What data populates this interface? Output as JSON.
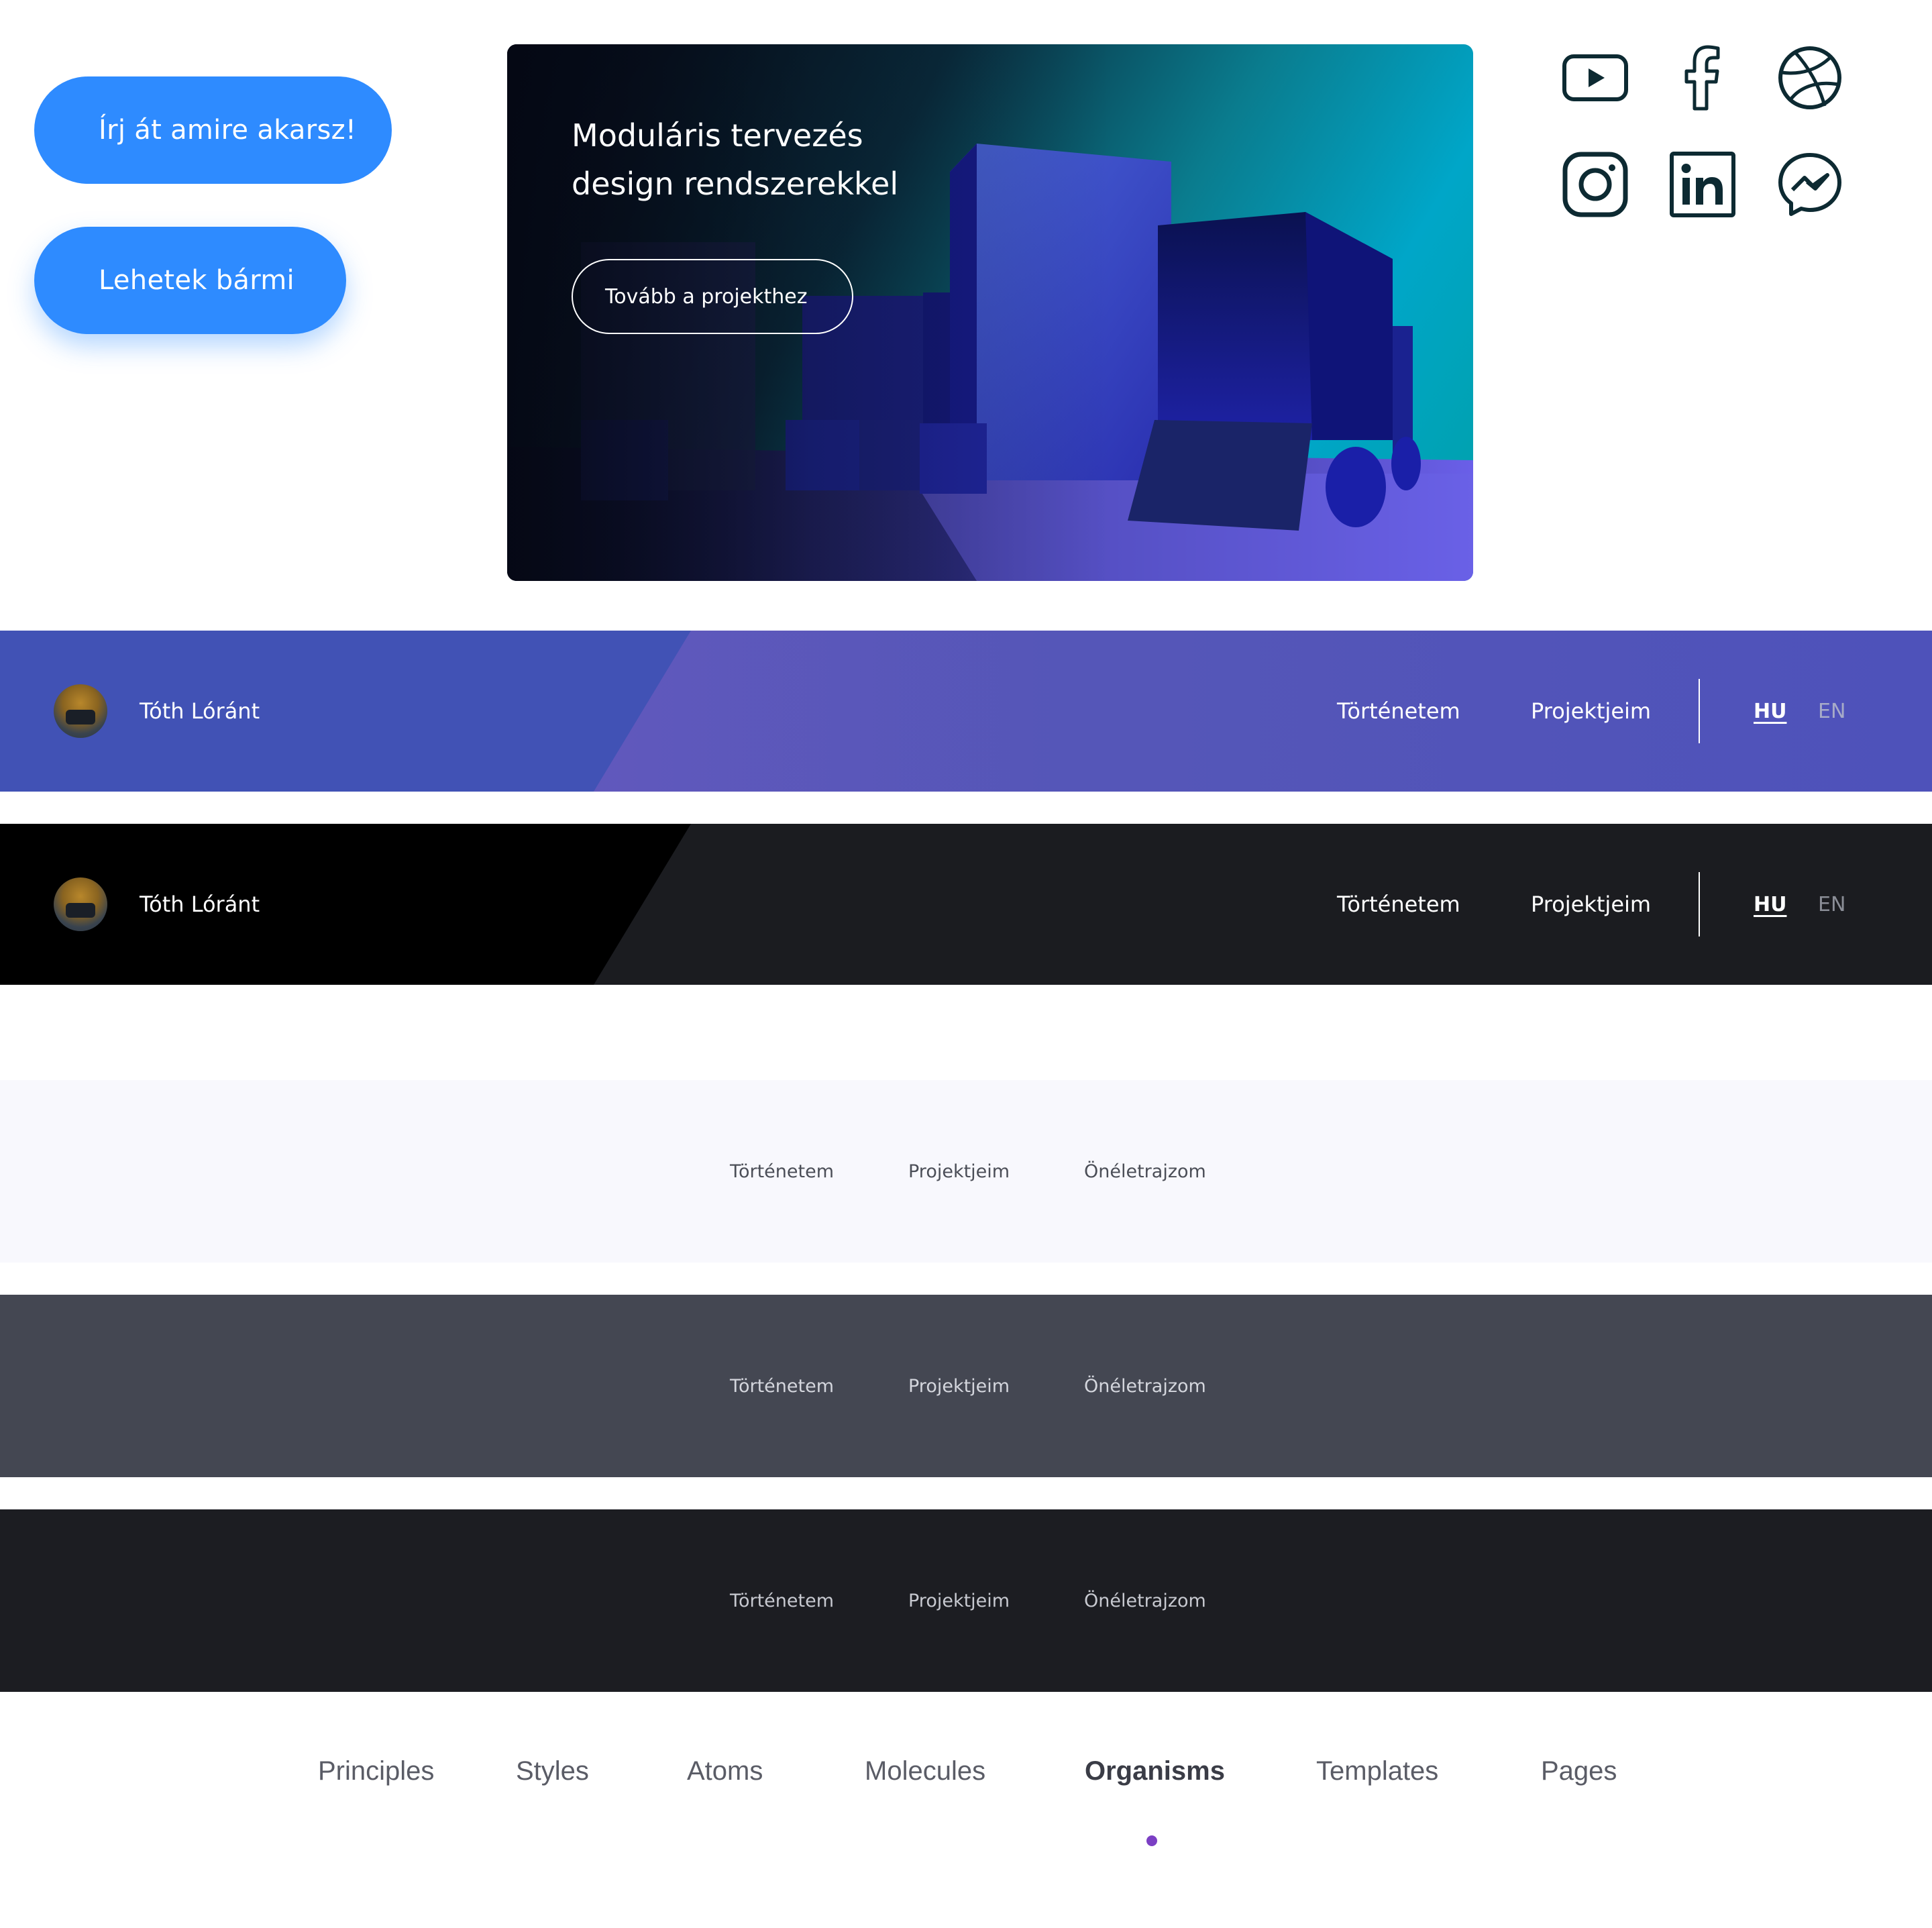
{
  "buttons": {
    "primary_label": "Írj át amire akarsz!",
    "secondary_label": "Lehetek bármi"
  },
  "hero": {
    "title_line1": "Moduláris tervezés",
    "title_line2": "design rendszerekkel",
    "cta_label": "Tovább a projekthez"
  },
  "social": [
    {
      "icon": "youtube-icon"
    },
    {
      "icon": "facebook-icon"
    },
    {
      "icon": "dribbble-icon"
    },
    {
      "icon": "instagram-icon"
    },
    {
      "icon": "linkedin-icon"
    },
    {
      "icon": "messenger-icon"
    }
  ],
  "header_blue": {
    "name": "Tóth Lóránt",
    "nav": [
      "Történetem",
      "Projektjeim"
    ],
    "lang_active": "HU",
    "lang_other": "EN"
  },
  "header_dark": {
    "name": "Tóth Lóránt",
    "nav": [
      "Történetem",
      "Projektjeim"
    ],
    "lang_active": "HU",
    "lang_other": "EN"
  },
  "nav_light": {
    "items": [
      "Történetem",
      "Projektjeim",
      "Önéletrajzom"
    ]
  },
  "nav_gray": {
    "items": [
      "Történetem",
      "Projektjeim",
      "Önéletrajzom"
    ]
  },
  "nav_dark": {
    "items": [
      "Történetem",
      "Projektjeim",
      "Önéletrajzom"
    ]
  },
  "tabs": {
    "items": [
      "Principles",
      "Styles",
      "Atoms",
      "Molecules",
      "Organisms",
      "Templates",
      "Pages"
    ],
    "active": "Organisms"
  },
  "colors": {
    "button_blue": "#2e8bff",
    "header_blue": "#4152b5",
    "header_purple": "#5356b7",
    "active_dot": "#7b3fc4",
    "icon_stroke": "#0d2a32"
  }
}
